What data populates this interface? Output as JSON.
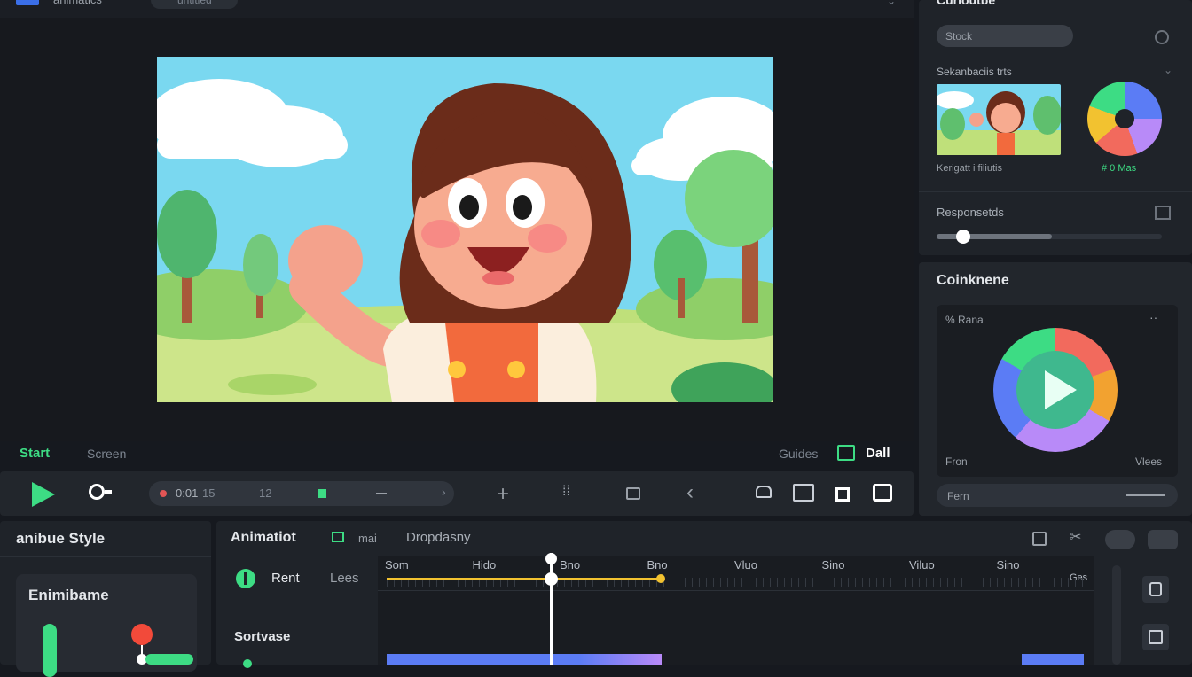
{
  "app": {
    "title": "animatics",
    "top_chip": "untitled"
  },
  "preview_bar": {
    "start_label": "Start",
    "mode_label": "Screen",
    "right_label": "Guides",
    "end_label": "Dall"
  },
  "transport": {
    "time": "0:01",
    "fps": "15",
    "field_value": "12"
  },
  "right_panel": {
    "title": "Curioutbe",
    "search_placeholder": "Stock",
    "thumbnails_label": "Sekanbaciis trts",
    "thumb_caption": "Kerigatt i filiutis",
    "color_caption": "# 0 Mas",
    "param_label": "Responsetds",
    "slider_value": 0.12
  },
  "colors_panel": {
    "title": "Coinknene",
    "inner_label": "% Rana",
    "left_label": "Fron",
    "right_label": "Vlees",
    "bottom_field": "Fern"
  },
  "style_panel": {
    "title": "anibue Style",
    "card_title": "Enimibame"
  },
  "timeline": {
    "title": "Animatiot",
    "menu_label": "mai",
    "tab_label": "Dropdasny",
    "track1_label": "Rent",
    "track1_right": "Lees",
    "track2_label": "Sortvase",
    "ruler_ticks": [
      "Som",
      "Hido",
      "Bno",
      "Bno",
      "Vluo",
      "Sino",
      "Viluo",
      "Sino"
    ],
    "ruler_end": "Ges",
    "playhead_fraction": 0.25
  },
  "colors": {
    "accent": "#3ddc84",
    "track_yellow": "#f2c230",
    "clip_blue": "#5b7cf5",
    "clip_purple": "#b88af8"
  }
}
